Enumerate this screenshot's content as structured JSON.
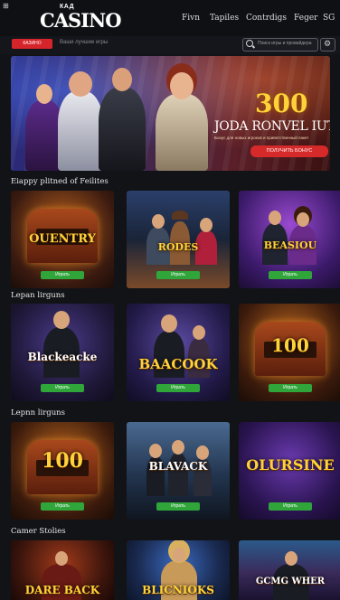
{
  "header": {
    "corner_icon": "⊞",
    "logo_small": "КАД",
    "logo_main": "CASINO",
    "nav": [
      "Fivn",
      "Tapiles",
      "Contrdigs",
      "Feger",
      "SG"
    ]
  },
  "toolbar": {
    "red_button": "КАЗИНО",
    "filter_text": "Ваши лучшие игры",
    "search_placeholder": "Поиск игры и провайдера",
    "settings_icon": "gear-icon"
  },
  "hero": {
    "amount": "300",
    "title": "JODA RONVEL IUTU",
    "subtitle": "Бонус для новых игроков и приветственный пакет",
    "cta": "ПОЛУЧИТЬ БОНУС"
  },
  "sections": [
    {
      "title": "Eiappy plitned of Feilites",
      "cards": [
        {
          "title": "OUENTRY",
          "button": "Играть"
        },
        {
          "title": "RODES",
          "button": "Играть"
        },
        {
          "title": "BEASIOU",
          "button": "Играть"
        }
      ]
    },
    {
      "title": "Lepan lirguns",
      "cards": [
        {
          "title": "Blackeacke",
          "button": "Играть"
        },
        {
          "title": "BAACOOK",
          "button": "Играть"
        },
        {
          "title": "100",
          "button": "Играть"
        }
      ]
    },
    {
      "title": "Lepnn lirguns",
      "cards": [
        {
          "title": "100",
          "button": "Играть"
        },
        {
          "title": "BLAVACK",
          "button": "Играть"
        },
        {
          "title": "OLURSINE",
          "button": "Играть"
        }
      ]
    },
    {
      "title": "Camer Stolies",
      "cards": [
        {
          "title": "DARE BACK"
        },
        {
          "title": "BLICNIOKS"
        },
        {
          "title": "GCMG WHER"
        }
      ]
    }
  ],
  "colors": {
    "accent_red": "#d6252a",
    "play_green": "#2fa53a",
    "gold": "#ffd23a"
  }
}
